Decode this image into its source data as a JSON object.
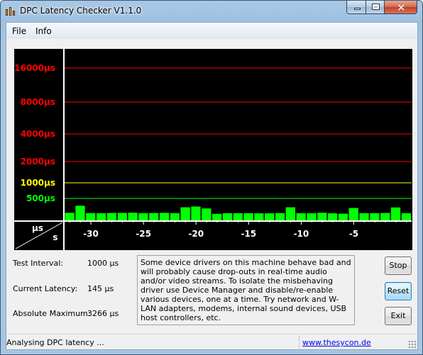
{
  "window": {
    "title": "DPC Latency Checker V1.1.0"
  },
  "menu": {
    "items": [
      "File",
      "Info"
    ]
  },
  "chart_data": {
    "type": "bar",
    "y_scale": "non-linear (step)",
    "y_tick_labels": [
      "16000µs",
      "8000µs",
      "4000µs",
      "2000µs",
      "1000µs",
      "500µs"
    ],
    "y_tick_values": [
      16000,
      8000,
      4000,
      2000,
      1000,
      500
    ],
    "y_tick_colors": [
      "#ff0000",
      "#ff0000",
      "#ff0000",
      "#ff0000",
      "#ffff00",
      "#00ff00"
    ],
    "x_ticks": [
      -30,
      -25,
      -20,
      -15,
      -10,
      -5
    ],
    "corner_labels": {
      "y_unit": "µs",
      "x_unit": "s"
    },
    "bar_color": "#00ff00",
    "values": [
      108,
      300,
      101,
      98,
      104,
      105,
      111,
      98,
      102,
      107,
      100,
      259,
      279,
      227,
      81,
      99,
      99,
      98,
      95,
      95,
      101,
      259,
      97,
      96,
      110,
      95,
      87,
      240,
      99,
      99,
      104,
      255,
      98
    ]
  },
  "info": {
    "test_interval": {
      "label": "Test Interval:",
      "value": "1000 µs"
    },
    "current_latency": {
      "label": "Current Latency:",
      "value": "145 µs"
    },
    "absolute_maximum": {
      "label": "Absolute Maximum:",
      "value": "3266 µs"
    }
  },
  "description": "Some device drivers on this machine behave bad and will probably cause drop-outs in real-time audio and/or video streams. To isolate the misbehaving driver use Device Manager and disable/re-enable various devices, one at a time. Try network and W-LAN adapters, modems, internal sound devices, USB host controllers, etc.",
  "buttons": {
    "stop": "Stop",
    "reset": "Reset",
    "exit": "Exit"
  },
  "status": {
    "text": "Analysing DPC latency ...",
    "link": "www.thesycon.de"
  }
}
